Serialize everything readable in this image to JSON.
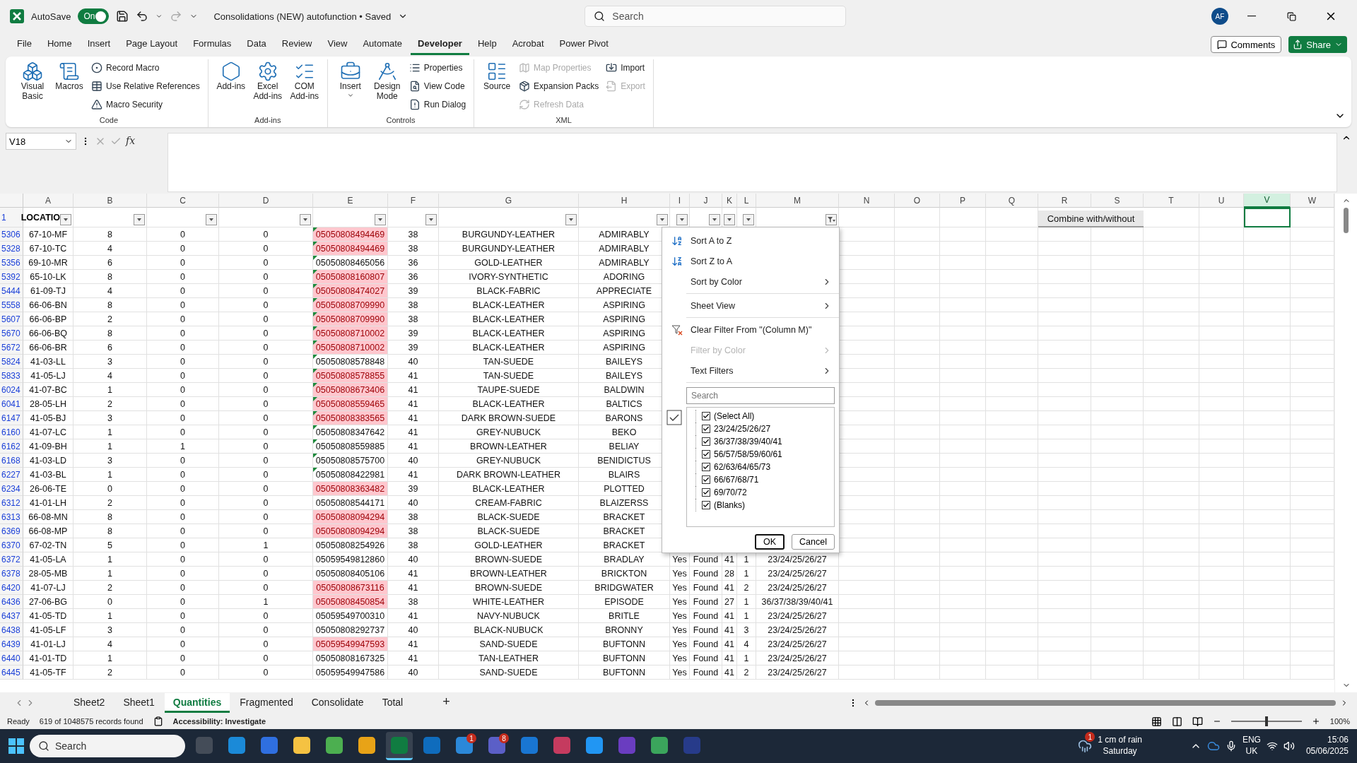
{
  "title_bar": {
    "autosave_label": "AutoSave",
    "autosave": {
      "on": true,
      "label": "On"
    },
    "document_title": "Consolidations (NEW) autofunction • Saved",
    "search": {
      "placeholder": "Search"
    },
    "avatar": "AF"
  },
  "menu_tabs": [
    {
      "label": "File",
      "selected": false
    },
    {
      "label": "Home",
      "selected": false
    },
    {
      "label": "Insert",
      "selected": false
    },
    {
      "label": "Page Layout",
      "selected": false
    },
    {
      "label": "Formulas",
      "selected": false
    },
    {
      "label": "Data",
      "selected": false
    },
    {
      "label": "Review",
      "selected": false
    },
    {
      "label": "View",
      "selected": false
    },
    {
      "label": "Automate",
      "selected": false
    },
    {
      "label": "Developer",
      "selected": true
    },
    {
      "label": "Help",
      "selected": false
    },
    {
      "label": "Acrobat",
      "selected": false
    },
    {
      "label": "Power Pivot",
      "selected": false
    }
  ],
  "comments_button": "Comments",
  "share_button": "Share",
  "ribbon_groups": [
    {
      "label": "Code",
      "items": [
        {
          "kind": "large",
          "label": "Visual Basic",
          "disabled": false
        },
        {
          "kind": "large",
          "label": "Macros",
          "disabled": false
        },
        {
          "kind": "small",
          "label": "Record Macro",
          "disabled": false
        },
        {
          "kind": "small",
          "label": "Use Relative References",
          "disabled": false
        },
        {
          "kind": "small",
          "label": "Macro Security",
          "disabled": false
        }
      ]
    },
    {
      "label": "Add-ins",
      "items": [
        {
          "kind": "large",
          "label": "Add-ins",
          "disabled": false
        },
        {
          "kind": "large",
          "label": "Excel Add-ins",
          "disabled": false
        },
        {
          "kind": "large",
          "label": "COM Add-ins",
          "disabled": false
        }
      ]
    },
    {
      "label": "Controls",
      "items": [
        {
          "kind": "dropdown",
          "label": "Insert",
          "disabled": false
        },
        {
          "kind": "large",
          "label": "Design Mode",
          "disabled": false
        },
        {
          "kind": "small",
          "label": "Properties",
          "disabled": false
        },
        {
          "kind": "small",
          "label": "View Code",
          "disabled": false
        },
        {
          "kind": "small",
          "label": "Run Dialog",
          "disabled": false
        }
      ]
    },
    {
      "label": "XML",
      "items": [
        {
          "kind": "large",
          "label": "Source",
          "disabled": false
        },
        {
          "kind": "small",
          "label": "Map Properties",
          "disabled": true
        },
        {
          "kind": "small",
          "label": "Expansion Packs",
          "disabled": false
        },
        {
          "kind": "small",
          "label": "Refresh Data",
          "disabled": true
        },
        {
          "kind": "small",
          "label": "Import",
          "disabled": false
        },
        {
          "kind": "small",
          "label": "Export",
          "disabled": true
        }
      ]
    }
  ],
  "formula_bar": {
    "name_box": "V18",
    "function_label": "fx"
  },
  "columns": [
    {
      "label": "A",
      "selected": false
    },
    {
      "label": "B",
      "selected": false
    },
    {
      "label": "C",
      "selected": false
    },
    {
      "label": "D",
      "selected": false
    },
    {
      "label": "E",
      "selected": false
    },
    {
      "label": "F",
      "selected": false
    },
    {
      "label": "G",
      "selected": false
    },
    {
      "label": "H",
      "selected": false
    },
    {
      "label": "I",
      "selected": false
    },
    {
      "label": "J",
      "selected": false
    },
    {
      "label": "K",
      "selected": false
    },
    {
      "label": "L",
      "selected": false
    },
    {
      "label": "M",
      "selected": false
    },
    {
      "label": "N",
      "selected": false
    },
    {
      "label": "O",
      "selected": false
    },
    {
      "label": "P",
      "selected": false
    },
    {
      "label": "Q",
      "selected": false
    },
    {
      "label": "R",
      "selected": false
    },
    {
      "label": "S",
      "selected": false
    },
    {
      "label": "T",
      "selected": false
    },
    {
      "label": "U",
      "selected": false
    },
    {
      "label": "V",
      "selected": true
    },
    {
      "label": "W",
      "selected": false
    }
  ],
  "header_row": {
    "number": "1",
    "first_heading": "LOCATIO",
    "filters": [
      {
        "filtered": false
      },
      {
        "filtered": false
      },
      {
        "filtered": false
      },
      {
        "filtered": false
      },
      {
        "filtered": false
      },
      {
        "filtered": false
      },
      {
        "filtered": false
      },
      {
        "filtered": false
      },
      {
        "filtered": false
      },
      {
        "filtered": false
      },
      {
        "filtered": false
      },
      {
        "filtered": false
      },
      {
        "filtered": true
      }
    ],
    "combine_button": "Combine with/without"
  },
  "rows": [
    {
      "number": "5306",
      "cells": [
        "67-10-MF",
        "8",
        "0",
        "0",
        "05050808494469",
        "38",
        "BURGUNDY-LEATHER",
        "ADMIRABLY"
      ],
      "highlighted": true,
      "flagged": true
    },
    {
      "number": "5328",
      "cells": [
        "67-10-TC",
        "4",
        "0",
        "0",
        "05050808494469",
        "38",
        "BURGUNDY-LEATHER",
        "ADMIRABLY"
      ],
      "highlighted": true,
      "flagged": true
    },
    {
      "number": "5356",
      "cells": [
        "69-10-MR",
        "6",
        "0",
        "0",
        "05050808465056",
        "36",
        "GOLD-LEATHER",
        "ADMIRABLY"
      ],
      "highlighted": false,
      "flagged": true
    },
    {
      "number": "5392",
      "cells": [
        "65-10-LK",
        "8",
        "0",
        "0",
        "05050808160807",
        "36",
        "IVORY-SYNTHETIC",
        "ADORING"
      ],
      "highlighted": true,
      "flagged": true
    },
    {
      "number": "5444",
      "cells": [
        "61-09-TJ",
        "4",
        "0",
        "0",
        "05050808474027",
        "39",
        "BLACK-FABRIC",
        "APPRECIATE"
      ],
      "highlighted": true,
      "flagged": true
    },
    {
      "number": "5558",
      "cells": [
        "66-06-BN",
        "8",
        "0",
        "0",
        "05050808709990",
        "38",
        "BLACK-LEATHER",
        "ASPIRING"
      ],
      "highlighted": true,
      "flagged": true
    },
    {
      "number": "5607",
      "cells": [
        "66-06-BP",
        "2",
        "0",
        "0",
        "05050808709990",
        "38",
        "BLACK-LEATHER",
        "ASPIRING"
      ],
      "highlighted": true,
      "flagged": true
    },
    {
      "number": "5670",
      "cells": [
        "66-06-BQ",
        "8",
        "0",
        "0",
        "05050808710002",
        "39",
        "BLACK-LEATHER",
        "ASPIRING"
      ],
      "highlighted": true,
      "flagged": true
    },
    {
      "number": "5672",
      "cells": [
        "66-06-BR",
        "6",
        "0",
        "0",
        "05050808710002",
        "39",
        "BLACK-LEATHER",
        "ASPIRING"
      ],
      "highlighted": true,
      "flagged": true
    },
    {
      "number": "5824",
      "cells": [
        "41-03-LL",
        "3",
        "0",
        "0",
        "05050808578848",
        "40",
        "TAN-SUEDE",
        "BAILEYS"
      ],
      "highlighted": false,
      "flagged": true
    },
    {
      "number": "5833",
      "cells": [
        "41-05-LJ",
        "4",
        "0",
        "0",
        "05050808578855",
        "41",
        "TAN-SUEDE",
        "BAILEYS"
      ],
      "highlighted": true,
      "flagged": true
    },
    {
      "number": "6024",
      "cells": [
        "41-07-BC",
        "1",
        "0",
        "0",
        "05050808673406",
        "41",
        "TAUPE-SUEDE",
        "BALDWIN"
      ],
      "highlighted": true,
      "flagged": true
    },
    {
      "number": "6041",
      "cells": [
        "28-05-LH",
        "2",
        "0",
        "0",
        "05050808559465",
        "41",
        "BLACK-LEATHER",
        "BALTICS"
      ],
      "highlighted": true,
      "flagged": true
    },
    {
      "number": "6147",
      "cells": [
        "41-05-BJ",
        "3",
        "0",
        "0",
        "05050808383565",
        "41",
        "DARK BROWN-SUEDE",
        "BARONS"
      ],
      "highlighted": true,
      "flagged": true
    },
    {
      "number": "6160",
      "cells": [
        "41-07-LC",
        "1",
        "0",
        "0",
        "05050808347642",
        "41",
        "GREY-NUBUCK",
        "BEKO"
      ],
      "highlighted": false,
      "flagged": true
    },
    {
      "number": "6162",
      "cells": [
        "41-09-BH",
        "1",
        "1",
        "0",
        "05050808559885",
        "41",
        "BROWN-LEATHER",
        "BELIAY"
      ],
      "highlighted": false,
      "flagged": true
    },
    {
      "number": "6168",
      "cells": [
        "41-03-LD",
        "3",
        "0",
        "0",
        "05050808575700",
        "40",
        "GREY-NUBUCK",
        "BENIDICTUS"
      ],
      "highlighted": false,
      "flagged": true
    },
    {
      "number": "6227",
      "cells": [
        "41-03-BL",
        "1",
        "0",
        "0",
        "05050808422981",
        "41",
        "DARK BROWN-LEATHER",
        "BLAIRS"
      ],
      "highlighted": false,
      "flagged": true
    },
    {
      "number": "6234",
      "cells": [
        "26-06-TE",
        "0",
        "0",
        "0",
        "05050808363482",
        "39",
        "BLACK-LEATHER",
        "PLOTTED"
      ],
      "highlighted": true,
      "flagged": false
    },
    {
      "number": "6312",
      "cells": [
        "41-01-LH",
        "2",
        "0",
        "0",
        "05050808544171",
        "40",
        "CREAM-FABRIC",
        "BLAIZERSS"
      ],
      "highlighted": false,
      "flagged": false
    },
    {
      "number": "6313",
      "cells": [
        "66-08-MN",
        "8",
        "0",
        "0",
        "05050808094294",
        "38",
        "BLACK-SUEDE",
        "BRACKET"
      ],
      "highlighted": true,
      "flagged": false
    },
    {
      "number": "6369",
      "cells": [
        "66-08-MP",
        "8",
        "0",
        "0",
        "05050808094294",
        "38",
        "BLACK-SUEDE",
        "BRACKET"
      ],
      "highlighted": true,
      "flagged": false
    },
    {
      "number": "6370",
      "cells": [
        "67-02-TN",
        "5",
        "0",
        "1",
        "05050808254926",
        "38",
        "GOLD-LEATHER",
        "BRACKET"
      ],
      "highlighted": false,
      "flagged": false
    },
    {
      "number": "6372",
      "cells": [
        "41-05-LA",
        "1",
        "0",
        "0",
        "05059549812860",
        "40",
        "BROWN-SUEDE",
        "BRADLAY",
        "Yes",
        "Found",
        "41",
        "1",
        "23/24/25/26/27"
      ],
      "highlighted": false,
      "flagged": false
    },
    {
      "number": "6378",
      "cells": [
        "28-05-MB",
        "1",
        "0",
        "0",
        "05050808405106",
        "41",
        "BROWN-LEATHER",
        "BRICKTON",
        "Yes",
        "Found",
        "28",
        "1",
        "23/24/25/26/27"
      ],
      "highlighted": false,
      "flagged": false
    },
    {
      "number": "6420",
      "cells": [
        "41-07-LJ",
        "2",
        "0",
        "0",
        "05050808673116",
        "41",
        "BROWN-SUEDE",
        "BRIDGWATER",
        "Yes",
        "Found",
        "41",
        "2",
        "23/24/25/26/27"
      ],
      "highlighted": true,
      "flagged": false
    },
    {
      "number": "6436",
      "cells": [
        "27-06-BG",
        "0",
        "0",
        "1",
        "05050808450854",
        "38",
        "WHITE-LEATHER",
        "EPISODE",
        "Yes",
        "Found",
        "27",
        "1",
        "36/37/38/39/40/41"
      ],
      "highlighted": true,
      "flagged": false
    },
    {
      "number": "6437",
      "cells": [
        "41-05-TD",
        "1",
        "0",
        "0",
        "05059549700310",
        "41",
        "NAVY-NUBUCK",
        "BRITLE",
        "Yes",
        "Found",
        "41",
        "1",
        "23/24/25/26/27"
      ],
      "highlighted": false,
      "flagged": false
    },
    {
      "number": "6438",
      "cells": [
        "41-05-LF",
        "3",
        "0",
        "0",
        "05050808292737",
        "40",
        "BLACK-NUBUCK",
        "BRONNY",
        "Yes",
        "Found",
        "41",
        "3",
        "23/24/25/26/27"
      ],
      "highlighted": false,
      "flagged": false
    },
    {
      "number": "6439",
      "cells": [
        "41-01-LJ",
        "4",
        "0",
        "0",
        "05059549947593",
        "41",
        "SAND-SUEDE",
        "BUFTONN",
        "Yes",
        "Found",
        "41",
        "4",
        "23/24/25/26/27"
      ],
      "highlighted": true,
      "flagged": false
    },
    {
      "number": "6440",
      "cells": [
        "41-01-TD",
        "1",
        "0",
        "0",
        "05050808167325",
        "41",
        "TAN-LEATHER",
        "BUFTONN",
        "Yes",
        "Found",
        "41",
        "1",
        "23/24/25/26/27"
      ],
      "highlighted": false,
      "flagged": false
    },
    {
      "number": "6445",
      "cells": [
        "41-05-TF",
        "2",
        "0",
        "0",
        "05059549947586",
        "40",
        "SAND-SUEDE",
        "BUFTONN",
        "Yes",
        "Found",
        "41",
        "2",
        "23/24/25/26/27"
      ],
      "highlighted": false,
      "flagged": false
    }
  ],
  "filter_menu": {
    "items": [
      {
        "kind": "sort_az",
        "label": "Sort A to Z",
        "disabled": false
      },
      {
        "kind": "sort_za",
        "label": "Sort Z to A",
        "disabled": false
      },
      {
        "kind": "submenu",
        "label": "Sort by Color",
        "disabled": false
      },
      {
        "kind": "divider"
      },
      {
        "kind": "submenu",
        "label": "Sheet View",
        "disabled": false
      },
      {
        "kind": "divider"
      },
      {
        "kind": "clear",
        "label": "Clear Filter From \"(Column M)\"",
        "disabled": false
      },
      {
        "kind": "submenu",
        "label": "Filter by Color",
        "disabled": true
      },
      {
        "kind": "submenu",
        "label": "Text Filters",
        "disabled": false
      },
      {
        "kind": "divider"
      }
    ],
    "search": {
      "placeholder": "Search"
    },
    "values": [
      {
        "label": "(Select All)",
        "checked": true
      },
      {
        "label": "23/24/25/26/27",
        "checked": true
      },
      {
        "label": "36/37/38/39/40/41",
        "checked": true
      },
      {
        "label": "56/57/58/59/60/61",
        "checked": true
      },
      {
        "label": "62/63/64/65/73",
        "checked": true
      },
      {
        "label": "66/67/68/71",
        "checked": true
      },
      {
        "label": "69/70/72",
        "checked": true
      },
      {
        "label": "(Blanks)",
        "checked": true
      }
    ],
    "ok_button": "OK",
    "cancel_button": "Cancel"
  },
  "sheet_tabs": [
    {
      "label": "Sheet2",
      "selected": false
    },
    {
      "label": "Sheet1",
      "selected": false
    },
    {
      "label": "Quantities",
      "selected": true
    },
    {
      "label": "Fragmented",
      "selected": false
    },
    {
      "label": "Consolidate",
      "selected": false
    },
    {
      "label": "Total",
      "selected": false
    }
  ],
  "add_sheet": "+",
  "status_bar": {
    "ready": "Ready",
    "records": "619 of 1048575 records found",
    "accessibility": "Accessibility: Investigate",
    "zoom": {
      "level": 0.5,
      "label": "100%"
    }
  },
  "taskbar": {
    "search": {
      "placeholder": "Search"
    },
    "apps": [
      {
        "active": false
      },
      {
        "active": false
      },
      {
        "active": false
      },
      {
        "active": false
      },
      {
        "active": false
      },
      {
        "active": false
      },
      {
        "active": true
      },
      {
        "active": false
      },
      {
        "active": false,
        "badge": "1"
      },
      {
        "active": false,
        "badge": "8"
      },
      {
        "active": false
      },
      {
        "active": false
      },
      {
        "active": false
      },
      {
        "active": false
      },
      {
        "active": false
      },
      {
        "active": false
      }
    ],
    "weather": {
      "badge": "1",
      "line1": "1 cm of rain",
      "line2": "Saturday"
    },
    "language": "ENG",
    "region": "UK",
    "time": "15:06",
    "date": "05/06/2025"
  }
}
